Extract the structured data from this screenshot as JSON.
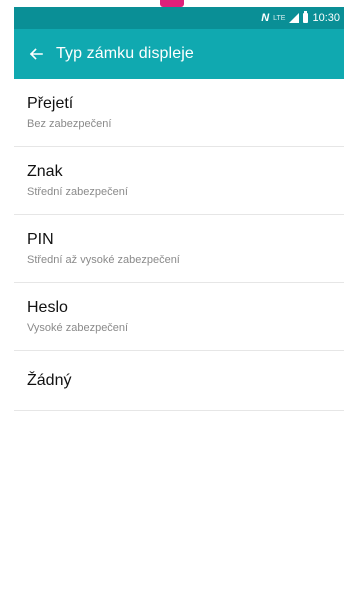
{
  "status_bar": {
    "nfc_label": "N",
    "lte_label": "LTE",
    "time": "10:30",
    "colors": {
      "status": "#0a8f96",
      "appbar": "#10a9b0",
      "marker": "#e0207a"
    },
    "icons": [
      "nfc-icon",
      "lte-icon",
      "signal-icon",
      "battery-icon"
    ]
  },
  "app_bar": {
    "back_icon": "arrow-left-icon",
    "title": "Typ zámku displeje"
  },
  "lock_types": [
    {
      "title": "Přejetí",
      "subtitle": "Bez zabezpečení"
    },
    {
      "title": "Znak",
      "subtitle": "Střední zabezpečení"
    },
    {
      "title": "PIN",
      "subtitle": "Střední až vysoké zabezpečení"
    },
    {
      "title": "Heslo",
      "subtitle": "Vysoké zabezpečení"
    },
    {
      "title": "Žádný"
    }
  ]
}
